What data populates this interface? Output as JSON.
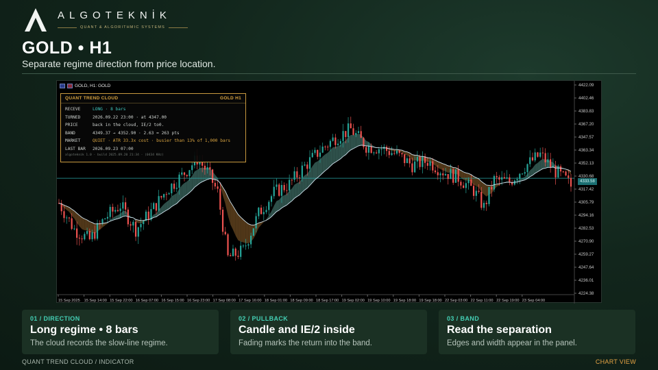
{
  "brand": {
    "name": "ALGOTEKNİK",
    "tagline": "QUANT & ALGORITHMIC SYSTEMS"
  },
  "header": {
    "title": "GOLD • H1",
    "subtitle": "Separate regime direction from price location."
  },
  "chart": {
    "header_label": "GOLD, H1:  GOLD",
    "current_price": "4333.58",
    "colors": {
      "bull": "#26a69a",
      "bear": "#ef5350",
      "cloud_bull": "#3d6b63",
      "cloud_bear": "#6b4a22",
      "line": "#cfe3ee",
      "grid": "#1a1a1a"
    }
  },
  "panel": {
    "title": "QUANT TREND CLOUD",
    "symbol": "GOLD H1",
    "rows": [
      {
        "key": "RECEVE",
        "value": "LONG · 8 bars",
        "style": "long"
      },
      {
        "key": "TURNED",
        "value": "2026.09.22 23:00 · at 4347.00",
        "style": ""
      },
      {
        "key": "PRICE",
        "value": "back in the cloud, IE/2 to0.",
        "style": ""
      },
      {
        "key": "BAND",
        "value": "4349.37 → 4352.90 · 2.63 = 263 pts",
        "style": ""
      },
      {
        "key": "MARKET",
        "value": "QUIET · ATR 33.3x cost · busier than 13% of 1,000 bars",
        "style": "quiet"
      },
      {
        "key": "LAST BAR",
        "value": "2026.09.23 07:00",
        "style": ""
      }
    ],
    "footer": "algoteknik 1.0 · build 2025.09.20 21:34 · (0434 KHz)"
  },
  "cards": [
    {
      "tag": "01 / DIRECTION",
      "title": "Long regime • 8 bars",
      "desc": "The cloud records the slow-line regime."
    },
    {
      "tag": "02 / PULLBACK",
      "title": "Candle and IE/2 inside",
      "desc": "Fading marks the return into the band."
    },
    {
      "tag": "03 / BAND",
      "title": "Read the separation",
      "desc": "Edges and width appear in the panel."
    }
  ],
  "footer": {
    "left": "QUANT TREND CLOUD / INDICATOR",
    "right": "CHART VIEW"
  },
  "chart_data": {
    "type": "candlestick",
    "y_ticks": [
      "4422.09",
      "4402.46",
      "4383.83",
      "4367.20",
      "4347.57",
      "4363.34",
      "4352.13",
      "4330.68",
      "4317.42",
      "4305.79",
      "4294.16",
      "4282.53",
      "4270.90",
      "4259.27",
      "4247.64",
      "4236.01",
      "4224.38"
    ],
    "ylim": [
      4224.38,
      4422.09
    ],
    "x_ticks": [
      "15 Sep 2025",
      "15 Sep 14:00",
      "15 Sep 22:00",
      "16 Sep 07:00",
      "16 Sep 15:00",
      "16 Sep 23:00",
      "17 Sep 08:00",
      "17 Sep 16:00",
      "18 Sep 01:00",
      "18 Sep 09:00",
      "18 Sep 17:00",
      "19 Sep 02:00",
      "19 Sep 10:00",
      "19 Sep 18:00",
      "19 Sep 18:00",
      "22 Sep 03:00",
      "22 Sep 11:00",
      "22 Sep 19:00",
      "23 Sep 04:00"
    ],
    "current_price": 4333.58,
    "ohlc_keypoints": [
      {
        "i": 0,
        "c": 4310
      },
      {
        "i": 6,
        "c": 4285
      },
      {
        "i": 12,
        "c": 4275
      },
      {
        "i": 18,
        "c": 4296
      },
      {
        "i": 24,
        "c": 4308
      },
      {
        "i": 30,
        "c": 4285
      },
      {
        "i": 36,
        "c": 4302
      },
      {
        "i": 42,
        "c": 4322
      },
      {
        "i": 48,
        "c": 4336
      },
      {
        "i": 54,
        "c": 4352
      },
      {
        "i": 58,
        "c": 4340
      },
      {
        "i": 62,
        "c": 4320
      },
      {
        "i": 66,
        "c": 4258
      },
      {
        "i": 72,
        "c": 4265
      },
      {
        "i": 78,
        "c": 4300
      },
      {
        "i": 84,
        "c": 4320
      },
      {
        "i": 90,
        "c": 4328
      },
      {
        "i": 96,
        "c": 4345
      },
      {
        "i": 102,
        "c": 4360
      },
      {
        "i": 108,
        "c": 4372
      },
      {
        "i": 114,
        "c": 4380
      },
      {
        "i": 120,
        "c": 4364
      },
      {
        "i": 126,
        "c": 4362
      },
      {
        "i": 132,
        "c": 4356
      },
      {
        "i": 138,
        "c": 4346
      },
      {
        "i": 144,
        "c": 4350
      },
      {
        "i": 150,
        "c": 4340
      },
      {
        "i": 156,
        "c": 4334
      },
      {
        "i": 162,
        "c": 4322
      },
      {
        "i": 166,
        "c": 4306
      },
      {
        "i": 170,
        "c": 4332
      },
      {
        "i": 176,
        "c": 4330
      },
      {
        "i": 182,
        "c": 4345
      },
      {
        "i": 188,
        "c": 4356
      },
      {
        "i": 194,
        "c": 4340
      },
      {
        "i": 198,
        "c": 4332
      },
      {
        "i": 200,
        "c": 4326
      }
    ]
  }
}
